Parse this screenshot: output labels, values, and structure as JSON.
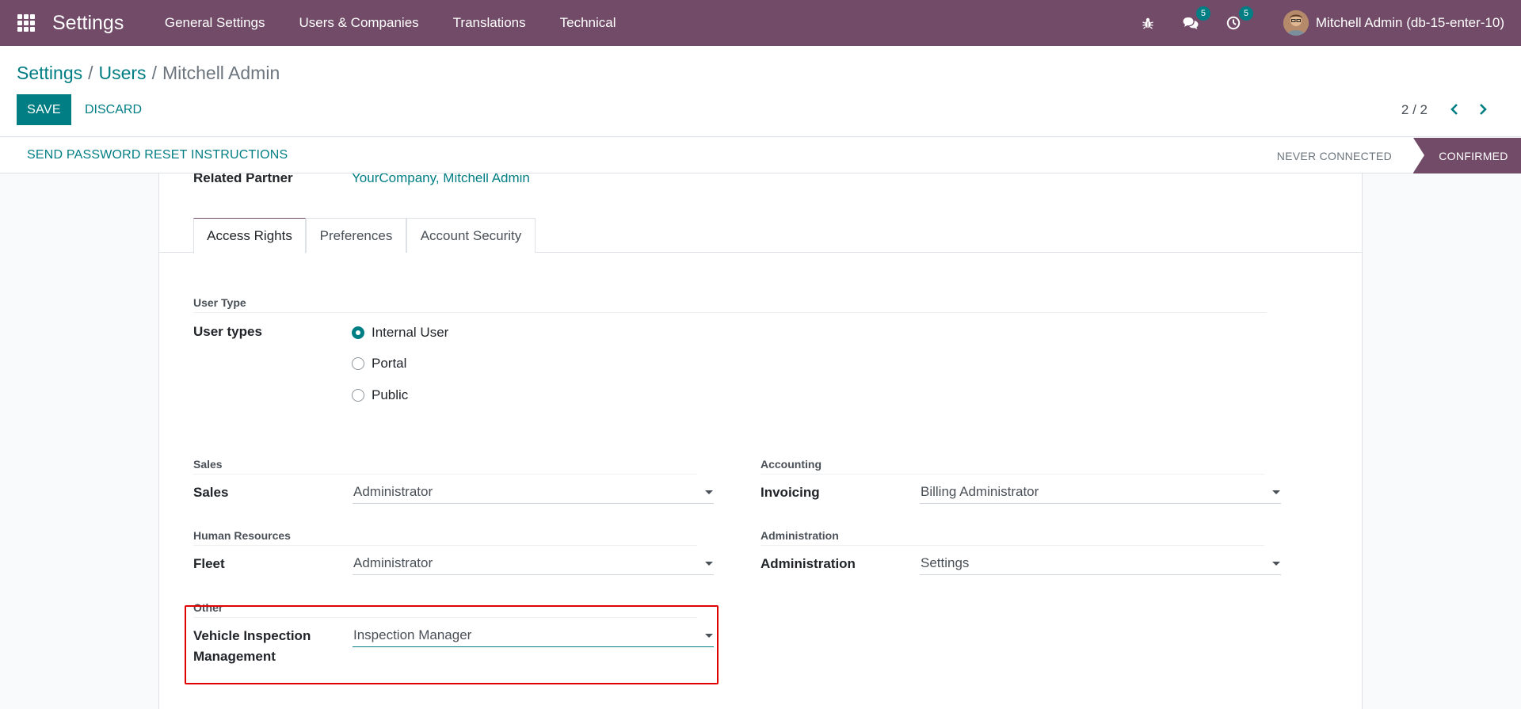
{
  "navbar": {
    "app_name": "Settings",
    "menu": [
      "General Settings",
      "Users & Companies",
      "Translations",
      "Technical"
    ],
    "messages_count": "5",
    "activities_count": "5",
    "user_name": "Mitchell Admin (db-15-enter-10)"
  },
  "breadcrumb": {
    "items": [
      "Settings",
      "Users"
    ],
    "current": "Mitchell Admin",
    "separator": "/"
  },
  "buttons": {
    "save": "SAVE",
    "discard": "DISCARD"
  },
  "pager": {
    "value": "2 / 2"
  },
  "statusbar": {
    "reset_button": "SEND PASSWORD RESET INSTRUCTIONS",
    "stages": [
      "NEVER CONNECTED",
      "CONFIRMED"
    ],
    "active_stage": "CONFIRMED"
  },
  "form": {
    "related_partner_label": "Related Partner",
    "related_partner_value": "YourCompany, Mitchell Admin",
    "tabs": [
      "Access Rights",
      "Preferences",
      "Account Security"
    ],
    "active_tab": "Access Rights",
    "user_type": {
      "section": "User Type",
      "label": "User types",
      "options": [
        "Internal User",
        "Portal",
        "Public"
      ],
      "selected": "Internal User"
    },
    "sales": {
      "section": "Sales",
      "label": "Sales",
      "value": "Administrator"
    },
    "accounting": {
      "section": "Accounting",
      "label": "Invoicing",
      "value": "Billing Administrator"
    },
    "human_resources": {
      "section": "Human Resources",
      "label": "Fleet",
      "value": "Administrator"
    },
    "administration": {
      "section": "Administration",
      "label": "Administration",
      "value": "Settings"
    },
    "other": {
      "section": "Other",
      "label_line1": "Vehicle Inspection",
      "label_line2": "Management",
      "value": "Inspection Manager"
    }
  },
  "colors": {
    "brand": "#714b67",
    "accent": "#017e84",
    "highlight": "#e00000"
  }
}
